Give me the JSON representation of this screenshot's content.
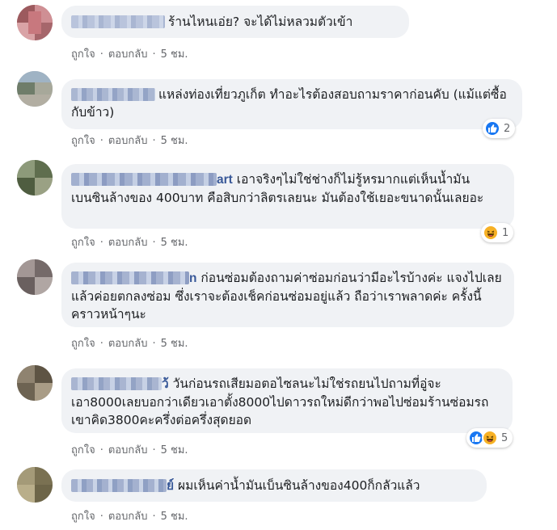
{
  "comments": [
    {
      "name_tail": "",
      "text": "ร้านไหนเอ่ย? จะได้ไม่หลวมตัวเข้า",
      "like_label": "ถูกใจ",
      "reply_label": "ตอบกลับ",
      "time": "5 ชม.",
      "avatar_color": "#c9858a",
      "reactions": null
    },
    {
      "name_tail": "",
      "text": "แหล่งท่องเที่ยวภูเก็ต ทำอะไรต้องสอบถามราคาก่อนคับ (แม้แต่ซื้อกับข้าว)",
      "like_label": "ถูกใจ",
      "reply_label": "ตอบกลับ",
      "time": "5 ชม.",
      "avatar_color": "#8fa0a8",
      "reactions": {
        "icons": [
          "like-icon"
        ],
        "count": "2"
      }
    },
    {
      "name_tail": "art",
      "text": "เอาจริงๆไม่ใช่ช่างก็ไม่รู้หรมากแต่เห็นน้ำมันเบนซินล้างของ 400บาท คือสิบกว่าลิตรเลยนะ มันต้องใช้เยอะขนาดนั้นเลยอะ",
      "like_label": "ถูกใจ",
      "reply_label": "ตอบกลับ",
      "time": "5 ชม.",
      "avatar_color": "#7c8a6a",
      "reactions": {
        "icons": [
          "haha-icon"
        ],
        "count": "1"
      }
    },
    {
      "name_tail": "n",
      "text": "ก่อนซ่อมต้องถามค่าซ่อมก่อนว่ามีอะไรบ้างค่ะ แจงไปเลย แล้วค่อยตกลงซ่อม ซึ่งเราจะต้องเช็คก่อนซ่อมอยู่แล้ว ถือว่าเราพลาดค่ะ ครั้งนี้ คราวหน้าๆนะ",
      "like_label": "ถูกใจ",
      "reply_label": "ตอบกลับ",
      "time": "5 ชม.",
      "avatar_color": "#8a8080",
      "reactions": null
    },
    {
      "name_tail": "ว้",
      "text": "วันก่อนรถเสียมอตอไซลนะไม่ใช่รถยนไปถามที่อู่จะเอา8000เลยบอกว่าเดียวเอาตั้ง8000ไปดาวรถใหม่ดีกว่าพอไปซ่อมร้านซ่อมรถเขาคิด3800คะครึ่งต่อครึ่งสุดยอด",
      "like_label": "ถูกใจ",
      "reply_label": "ตอบกลับ",
      "time": "5 ชม.",
      "avatar_color": "#7a7060",
      "reactions": {
        "icons": [
          "like-icon",
          "haha-icon"
        ],
        "count": "5"
      }
    },
    {
      "name_tail": "ย์",
      "text": "ผมเห็นค่าน้ำมันเบ็นซินล้างของ400ก็กลัวแล้ว",
      "like_label": "ถูกใจ",
      "reply_label": "ตอบกลับ",
      "time": "5 ชม.",
      "avatar_color": "#9a9070",
      "reactions": null
    }
  ],
  "colors": {
    "bubble_bg": "#f0f2f5",
    "meta_text": "#65676b",
    "name_link": "#385898",
    "like_blue": "#1877f2",
    "haha_yellow": "#f7b125"
  }
}
